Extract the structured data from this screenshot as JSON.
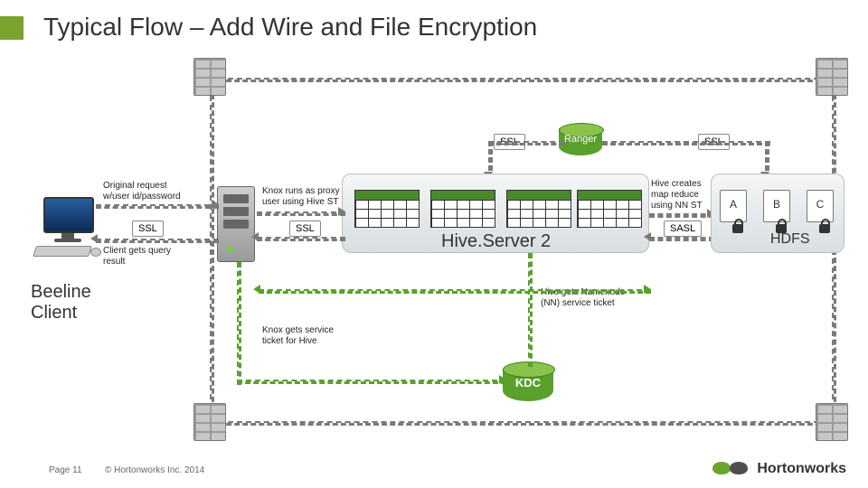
{
  "title": "Typical Flow – Add Wire and File Encryption",
  "labels": {
    "ssl_ranger_left": "SSL",
    "ssl_ranger_right": "SSL",
    "ranger": "Ranger",
    "original_request": "Original request w/user id/password",
    "knox_proxy": "Knox runs as proxy user using Hive ST",
    "ssl_client": "SSL",
    "ssl_knox": "SSL",
    "hive_mr": "Hive creates map reduce using NN ST",
    "sasl": "SASL",
    "client_result": "Client gets query result",
    "hiveserver": "Hive.Server 2",
    "beeline": "Beeline Client",
    "hive_nn": "Hive gets Namenode (NN) service ticket",
    "knox_ticket": "Knox gets service ticket for Hive",
    "kdc": "KDC",
    "hdfs": "HDFS",
    "nodeA": "A",
    "nodeB": "B",
    "nodeC": "C"
  },
  "footer": {
    "page": "Page 11",
    "copyright": "© Hortonworks Inc. 2014"
  },
  "brand": "Hortonworks"
}
